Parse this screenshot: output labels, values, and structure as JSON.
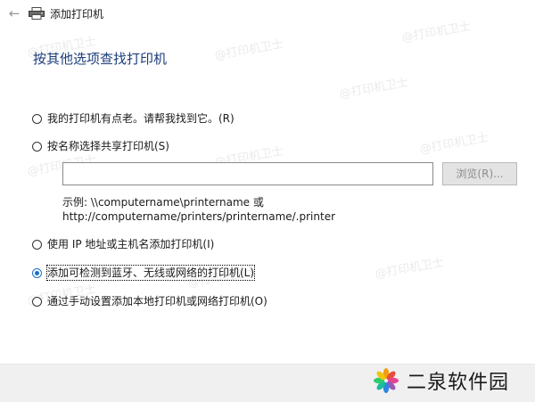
{
  "window": {
    "title": "添加打印机"
  },
  "heading": "按其他选项查找打印机",
  "options": [
    {
      "label": "我的打印机有点老。请帮我找到它。(R)",
      "checked": false
    },
    {
      "label": "按名称选择共享打印机(S)",
      "checked": false
    },
    {
      "label": "使用 IP 地址或主机名添加打印机(I)",
      "checked": false
    },
    {
      "label": "添加可检测到蓝牙、无线或网络的打印机(L)",
      "checked": true
    },
    {
      "label": "通过手动设置添加本地打印机或网络打印机(O)",
      "checked": false
    }
  ],
  "share": {
    "value": "",
    "browse_label": "浏览(R)..."
  },
  "example": {
    "line1": "示例: \\\\computername\\printername 或",
    "line2": "http://computername/printers/printername/.printer"
  },
  "watermark": "@打印机卫士",
  "site_badge": {
    "name": "二泉软件园"
  },
  "colors": {
    "heading": "#1c3d7a",
    "radio_checked": "#1a6fc8"
  }
}
